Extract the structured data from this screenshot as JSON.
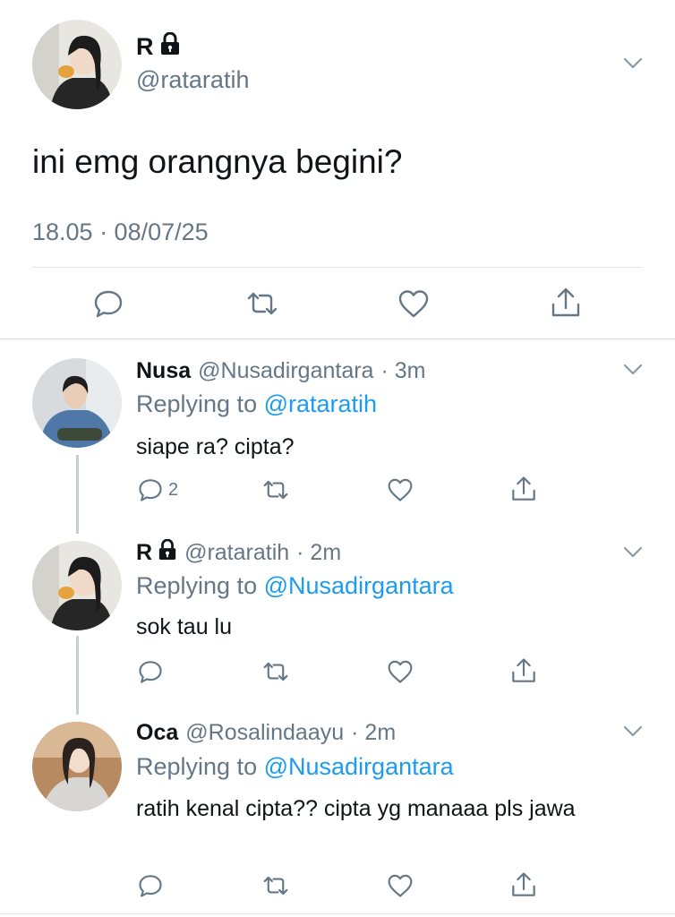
{
  "main_tweet": {
    "name": "R",
    "handle": "@rataratih",
    "text": "ini emg orangnya begini?",
    "timestamp": "18.05 · 08/07/25"
  },
  "replies": [
    {
      "name": "Nusa",
      "handle": "@Nusadirgantara",
      "time": "· 3m",
      "replying_prefix": "Replying to",
      "replying_to": "@rataratih",
      "text": "siape ra? cipta?",
      "reply_count": "2"
    },
    {
      "name": "R",
      "handle": "@rataratih",
      "time": "· 2m",
      "replying_prefix": "Replying to",
      "replying_to": "@Nusadirgantara",
      "text": "sok tau lu",
      "reply_count": ""
    },
    {
      "name": "Oca",
      "handle": "@Rosalindaayu",
      "time": "· 2m",
      "replying_prefix": "Replying to",
      "replying_to": "@Nusadirgantara",
      "text": "ratih kenal cipta?? cipta yg manaaa pls jawa",
      "reply_count": ""
    }
  ],
  "colors": {
    "link": "#1d9bf0",
    "muted": "#657786",
    "text": "#0f1419",
    "separator": "#e1e8ed"
  },
  "icons": [
    "lock-icon",
    "chevron-down-icon",
    "reply-icon",
    "retweet-icon",
    "like-icon",
    "share-icon"
  ]
}
